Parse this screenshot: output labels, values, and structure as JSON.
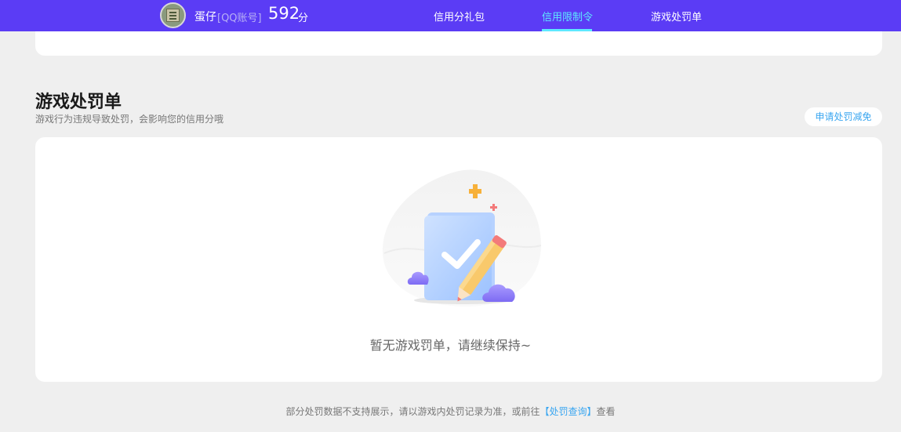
{
  "header": {
    "username": "蛋仔",
    "account": "[QQ账号]",
    "score": "592",
    "score_unit": "分",
    "nav": [
      {
        "label": "信用分礼包"
      },
      {
        "label": "信用限制令"
      },
      {
        "label": "游戏处罚单"
      }
    ],
    "accent_color": "#5b3cf5",
    "active_color": "#5ee8ff"
  },
  "section": {
    "title": "游戏处罚单",
    "subtitle": "游戏行为违规导致处罚，会影响您的信用分哦",
    "apply_button": "申请处罚减免"
  },
  "empty_state": {
    "icon": "document-pencil-icon",
    "message": "暂无游戏罚单，请继续保持~"
  },
  "footer": {
    "text": "部分处罚数据不支持展示，请以游戏内处罚记录为准，或前往",
    "link": "【处罚查询】",
    "suffix": "查看"
  }
}
